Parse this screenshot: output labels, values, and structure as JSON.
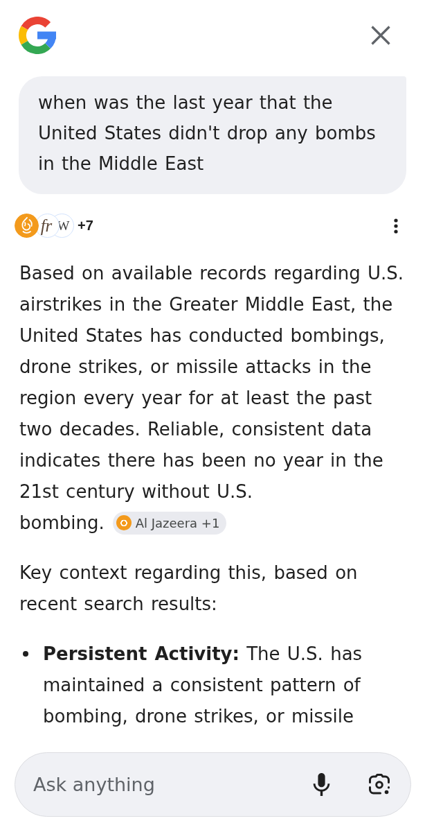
{
  "query": {
    "text": "when was the last year that the United States didn't drop any bombs in the Middle East"
  },
  "sources": {
    "logos": [
      {
        "kind": "emblem"
      },
      {
        "kind": "script",
        "text": "fr"
      },
      {
        "kind": "letter",
        "text": "W"
      }
    ],
    "more": "+7"
  },
  "answer": {
    "blocks": [
      {
        "kind": "paragraph",
        "text": "Based on available records regarding U.S. airstrikes in the Greater Middle East, the United States has conducted bombings, drone strikes, or missile attacks in the region every year for at least the past two decades. Reliable, consistent data indicates there has been no year in the 21st century without U.S. bombing.",
        "citation": {
          "label": "Al Jazeera +1"
        }
      },
      {
        "kind": "paragraph",
        "text": "Key context regarding this, based on recent search results:"
      },
      {
        "kind": "bullet",
        "text": "**Persistent Activity:** The U.S. has maintained a consistent pattern of bombing, drone strikes, or missile"
      }
    ]
  },
  "composer": {
    "placeholder": "Ask anything"
  }
}
